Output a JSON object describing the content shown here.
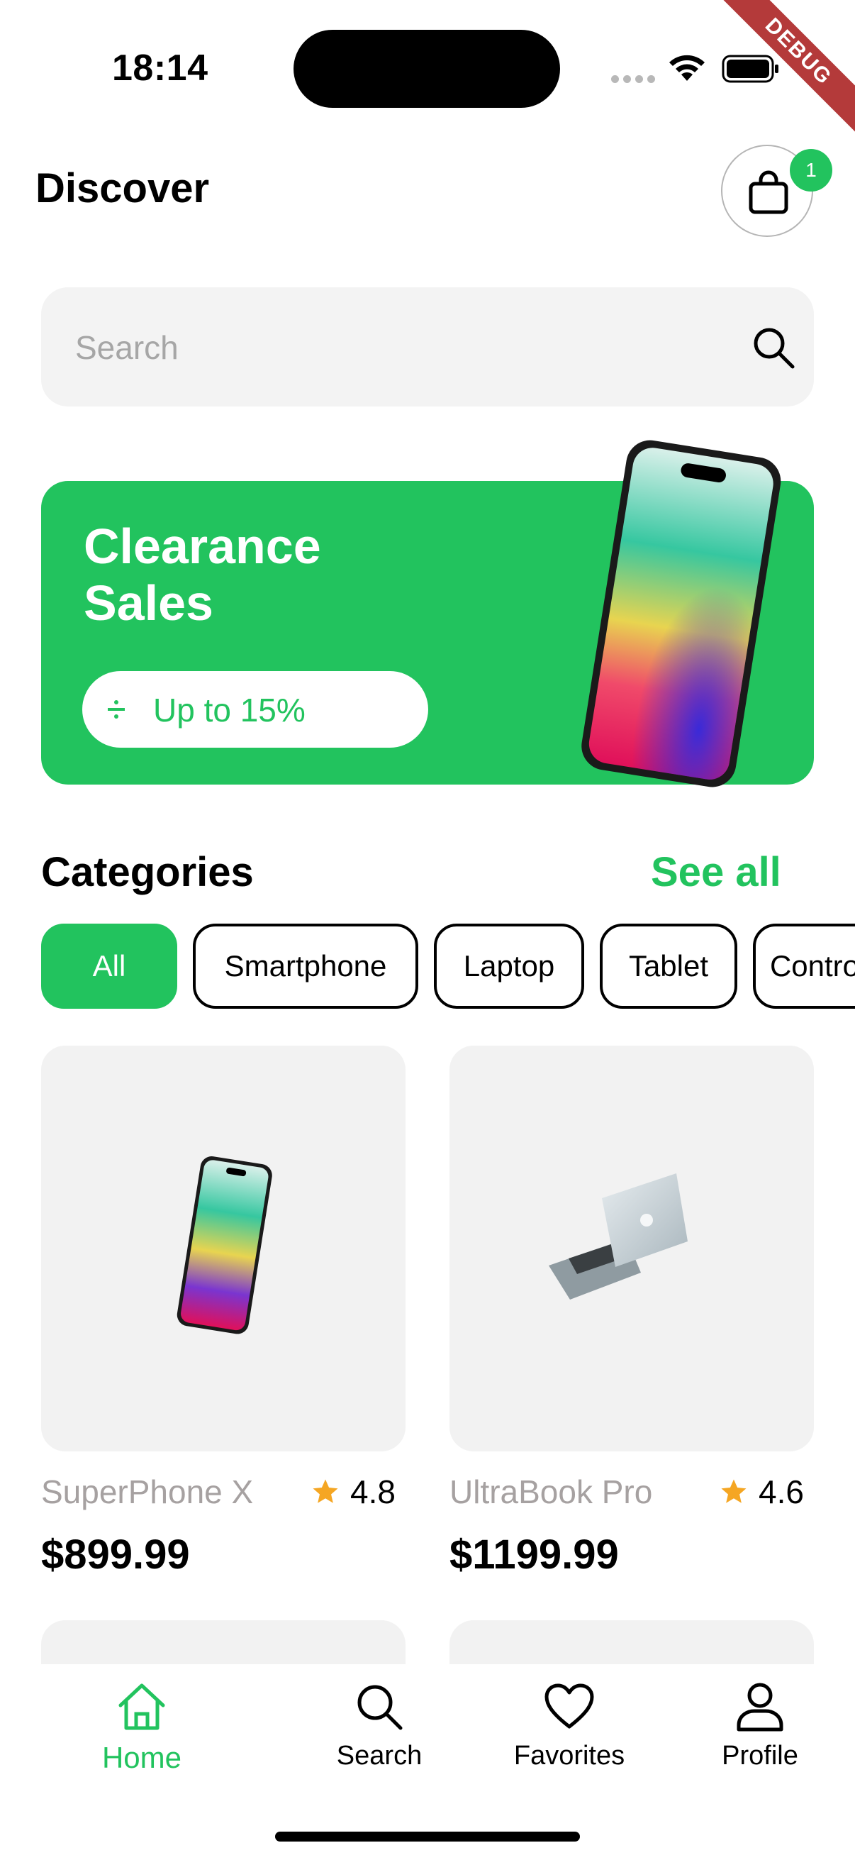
{
  "status_bar": {
    "time": "18:14",
    "debug_label": "DEBUG"
  },
  "header": {
    "title": "Discover",
    "cart_count": "1",
    "cart_icon": "shopping-bag-icon"
  },
  "search": {
    "placeholder": "Search",
    "value": "",
    "icon": "search-icon"
  },
  "banner": {
    "title": "Clearance Sales",
    "promo": "Up to 15%",
    "promo_icon": "percent-icon"
  },
  "categories": {
    "title": "Categories",
    "see_all": "See all",
    "items": [
      "All",
      "Smartphone",
      "Laptop",
      "Tablet",
      "Controller"
    ],
    "selected": "All"
  },
  "products": [
    {
      "name": "SuperPhone X",
      "rating": "4.8",
      "price": "$899.99"
    },
    {
      "name": "UltraBook Pro",
      "rating": "4.6",
      "price": "$1199.99"
    }
  ],
  "bottom_nav": [
    {
      "label": "Home",
      "icon": "home-icon",
      "active": true
    },
    {
      "label": "Search",
      "icon": "search-icon",
      "active": false
    },
    {
      "label": "Favorites",
      "icon": "heart-icon",
      "active": false
    },
    {
      "label": "Profile",
      "icon": "user-icon",
      "active": false
    }
  ],
  "colors": {
    "accent": "#22c35e",
    "muted_text": "#a6a1a1",
    "card_bg": "#f2f2f2",
    "star": "#f5a623"
  }
}
